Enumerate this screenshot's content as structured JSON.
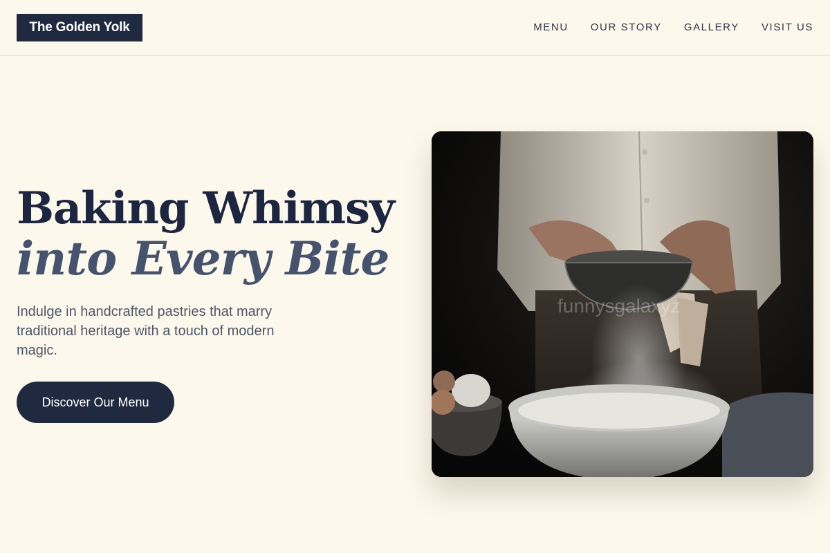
{
  "brand": {
    "name": "The Golden Yolk"
  },
  "nav": {
    "items": [
      "MENU",
      "OUR STORY",
      "GALLERY",
      "VISIT US"
    ]
  },
  "hero": {
    "title_line1": "Baking Whimsy",
    "title_line2": "into Every Bite",
    "subtitle": "Indulge in handcrafted pastries that marry traditional heritage with a touch of modern magic.",
    "cta_label": "Discover Our Menu",
    "image_watermark": "funnysgalaxyz"
  },
  "colors": {
    "background": "#fdf8ec",
    "navy": "#1f2a40",
    "slate": "#46536e",
    "text_muted": "#4c5568"
  }
}
